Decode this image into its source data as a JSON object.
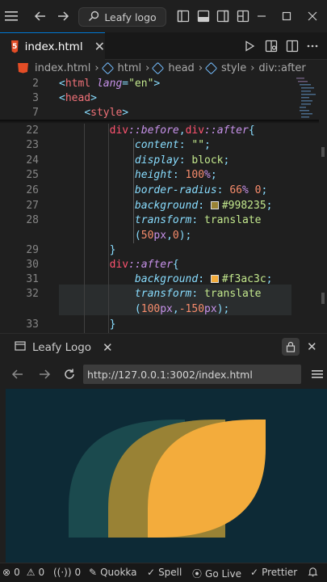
{
  "titlebar": {
    "search_text": "Leafy logo"
  },
  "tab": {
    "file_name": "index.html",
    "file_icon_text": "5"
  },
  "breadcrumb": {
    "items": [
      "index.html",
      "html",
      "head",
      "style",
      "div::after"
    ]
  },
  "editor": {
    "sticky": [
      {
        "ln": "2",
        "parts": [
          [
            "punc",
            "<"
          ],
          [
            "tag",
            "html"
          ],
          [
            "attr",
            " lang"
          ],
          [
            "punc",
            "="
          ],
          [
            "str",
            "\"en\""
          ],
          [
            "punc",
            ">"
          ]
        ]
      },
      {
        "ln": "3",
        "parts": [
          [
            "punc",
            "<"
          ],
          [
            "tag",
            "head"
          ],
          [
            "punc",
            ">"
          ]
        ]
      },
      {
        "ln": "7",
        "parts": [
          [
            "txt",
            "    "
          ],
          [
            "punc",
            "<"
          ],
          [
            "tag",
            "style"
          ],
          [
            "punc",
            ">"
          ]
        ]
      }
    ],
    "lines": [
      {
        "ln": "22",
        "parts": [
          [
            "txt",
            "        "
          ],
          [
            "sel",
            "div"
          ],
          [
            "pseudo",
            "::before"
          ],
          [
            "punc",
            ","
          ],
          [
            "sel",
            "div"
          ],
          [
            "pseudo",
            "::after"
          ],
          [
            "punc",
            "{"
          ]
        ]
      },
      {
        "ln": "23",
        "parts": [
          [
            "txt",
            "            "
          ],
          [
            "prop",
            "content"
          ],
          [
            "punc",
            ": "
          ],
          [
            "val",
            "\"\""
          ],
          [
            "punc",
            ";"
          ]
        ]
      },
      {
        "ln": "24",
        "parts": [
          [
            "txt",
            "            "
          ],
          [
            "prop",
            "display"
          ],
          [
            "punc",
            ": "
          ],
          [
            "val",
            "block"
          ],
          [
            "punc",
            ";"
          ]
        ]
      },
      {
        "ln": "25",
        "parts": [
          [
            "txt",
            "            "
          ],
          [
            "prop",
            "height"
          ],
          [
            "punc",
            ": "
          ],
          [
            "num",
            "100"
          ],
          [
            "unit",
            "%"
          ],
          [
            "punc",
            ";"
          ]
        ]
      },
      {
        "ln": "26",
        "parts": [
          [
            "txt",
            "            "
          ],
          [
            "prop",
            "border-radius"
          ],
          [
            "punc",
            ": "
          ],
          [
            "num",
            "66"
          ],
          [
            "unit",
            "%"
          ],
          [
            "txt",
            " "
          ],
          [
            "num",
            "0"
          ],
          [
            "punc",
            ";"
          ]
        ]
      },
      {
        "ln": "27",
        "parts": [
          [
            "txt",
            "            "
          ],
          [
            "prop",
            "background"
          ],
          [
            "punc",
            ": "
          ],
          [
            "swatch",
            "#998235"
          ],
          [
            "val",
            "#998235"
          ],
          [
            "punc",
            ";"
          ]
        ]
      },
      {
        "ln": "28",
        "parts": [
          [
            "txt",
            "            "
          ],
          [
            "prop",
            "transform"
          ],
          [
            "punc",
            ": "
          ],
          [
            "val",
            "translate"
          ]
        ]
      },
      {
        "ln": "",
        "parts": [
          [
            "txt",
            "            "
          ],
          [
            "punc",
            "("
          ],
          [
            "num",
            "50"
          ],
          [
            "unit",
            "px"
          ],
          [
            "punc",
            ","
          ],
          [
            "num",
            "0"
          ],
          [
            "punc",
            ");"
          ]
        ]
      },
      {
        "ln": "29",
        "parts": [
          [
            "txt",
            "        "
          ],
          [
            "punc",
            "}"
          ]
        ]
      },
      {
        "ln": "30",
        "parts": [
          [
            "txt",
            "        "
          ],
          [
            "sel",
            "div"
          ],
          [
            "pseudo",
            "::after"
          ],
          [
            "punc",
            "{"
          ]
        ]
      },
      {
        "ln": "31",
        "parts": [
          [
            "txt",
            "            "
          ],
          [
            "prop",
            "background"
          ],
          [
            "punc",
            ": "
          ],
          [
            "swatch",
            "#f3ac3c"
          ],
          [
            "val",
            "#f3ac3c"
          ],
          [
            "punc",
            ";"
          ]
        ]
      },
      {
        "ln": "32",
        "parts": [
          [
            "txt",
            "            "
          ],
          [
            "prop",
            "transform"
          ],
          [
            "punc",
            ": "
          ],
          [
            "val",
            "translate"
          ]
        ]
      },
      {
        "ln": "",
        "parts": [
          [
            "txt",
            "            "
          ],
          [
            "punc",
            "("
          ],
          [
            "num",
            "100"
          ],
          [
            "unit",
            "px"
          ],
          [
            "punc",
            ","
          ],
          [
            "num",
            "-150"
          ],
          [
            "unit",
            "px"
          ],
          [
            "punc",
            ");"
          ]
        ]
      },
      {
        "ln": "33",
        "parts": [
          [
            "txt",
            "        "
          ],
          [
            "punc",
            "}"
          ]
        ]
      }
    ]
  },
  "panel": {
    "tab_label": "Leafy Logo"
  },
  "browser": {
    "url": "http://127.0.0.1:3002/index.html"
  },
  "logo": {
    "background": "#0d2a36",
    "leaf_colors": [
      "#1b4a4e",
      "#998235",
      "#f3ac3c"
    ]
  },
  "statusbar": {
    "errors": "0",
    "warnings": "0",
    "ports": "0",
    "quokka": "Quokka",
    "spell": "Spell",
    "golive": "Go Live",
    "prettier": "Prettier"
  }
}
